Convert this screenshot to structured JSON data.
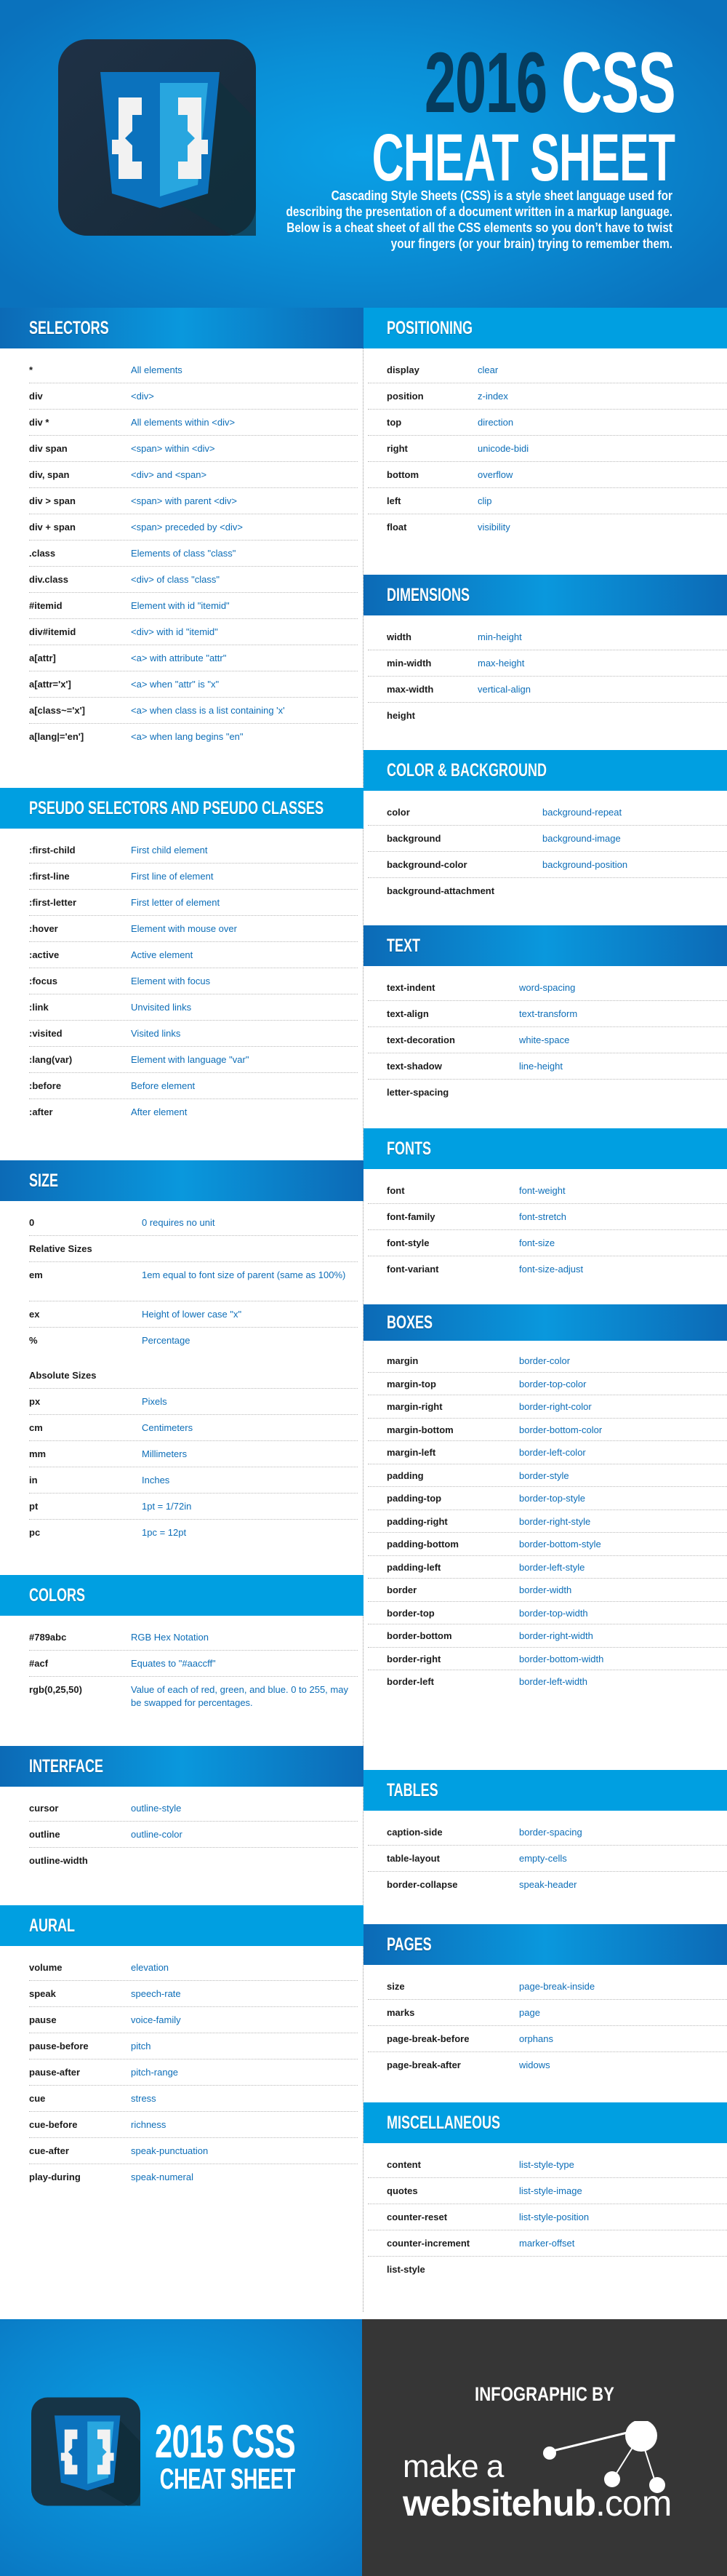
{
  "colors": {
    "accent_blue": "#009fe1",
    "dark_blue_header": "#0c6ab6",
    "title_navy": "#053c5e",
    "value_text_blue": "#0d6eb8",
    "footer_dark": "#363636"
  },
  "header": {
    "logo_icon": "css-braces-shield-icon",
    "title_year": "2016",
    "title_css": "CSS",
    "title_line2": "CHEAT SHEET",
    "intro": "Cascading Style Sheets (CSS) is a style sheet language used for describing the presentation of a document written in a markup language. Below is a cheat sheet of all the CSS elements so you don’t have to twist your fingers (or your brain) trying to remember them."
  },
  "left_column": {
    "selectors": {
      "title": "SELECTORS",
      "rows": [
        {
          "key": "*",
          "value": "All elements"
        },
        {
          "key": "div",
          "value": "<div>"
        },
        {
          "key": "div *",
          "value": "All elements within <div>"
        },
        {
          "key": "div span",
          "value": "<span> within <div>"
        },
        {
          "key": "div, span",
          "value": "<div> and <span>"
        },
        {
          "key": "div > span",
          "value": "<span> with parent <div>"
        },
        {
          "key": "div + span",
          "value": "<span> preceded by <div>"
        },
        {
          "key": ".class",
          "value": "Elements of class \"class\""
        },
        {
          "key": "div.class",
          "value": "<div> of class \"class\""
        },
        {
          "key": "#itemid",
          "value": "Element with id \"itemid\""
        },
        {
          "key": "div#itemid",
          "value": "<div> with id \"itemid\""
        },
        {
          "key": "a[attr]",
          "value": "<a> with attribute \"attr\""
        },
        {
          "key": "a[attr='x']",
          "value": "<a> when \"attr\" is \"x\""
        },
        {
          "key": "a[class~='x']",
          "value": "<a> when class is a list containing 'x'"
        },
        {
          "key": "a[lang|='en']",
          "value": "<a> when lang begins \"en\""
        }
      ]
    },
    "pseudo": {
      "title": "PSEUDO SELECTORS AND PSEUDO CLASSES",
      "rows": [
        {
          "key": ":first-child",
          "value": "First child element"
        },
        {
          "key": ":first-line",
          "value": "First line of element"
        },
        {
          "key": ":first-letter",
          "value": "First letter of element"
        },
        {
          "key": ":hover",
          "value": "Element with mouse over"
        },
        {
          "key": ":active",
          "value": "Active element"
        },
        {
          "key": ":focus",
          "value": "Element with focus"
        },
        {
          "key": ":link",
          "value": "Unvisited links"
        },
        {
          "key": ":visited",
          "value": "Visited links"
        },
        {
          "key": ":lang(var)",
          "value": "Element with language \"var\""
        },
        {
          "key": ":before",
          "value": "Before element"
        },
        {
          "key": ":after",
          "value": "After element"
        }
      ]
    },
    "size": {
      "title": "SIZE",
      "zero": {
        "key": "0",
        "value": "0 requires no unit"
      },
      "relative_label": "Relative Sizes",
      "relative": [
        {
          "key": "em",
          "value": "1em equal to font size of parent (same as 100%)"
        },
        {
          "key": "ex",
          "value": "Height of lower case \"x\""
        },
        {
          "key": "%",
          "value": "Percentage"
        }
      ],
      "absolute_label": "Absolute Sizes",
      "absolute": [
        {
          "key": "px",
          "value": "Pixels"
        },
        {
          "key": "cm",
          "value": "Centimeters"
        },
        {
          "key": "mm",
          "value": "Millimeters"
        },
        {
          "key": "in",
          "value": "Inches"
        },
        {
          "key": "pt",
          "value": "1pt = 1/72in"
        },
        {
          "key": "pc",
          "value": "1pc = 12pt"
        }
      ]
    },
    "colors": {
      "title": "COLORS",
      "rows": [
        {
          "key": "#789abc",
          "value": "RGB Hex Notation"
        },
        {
          "key": "#acf",
          "value": "Equates to \"#aaccff\""
        },
        {
          "key": "rgb(0,25,50)",
          "value": "Value of each of red, green, and blue. 0 to 255, may be swapped for percentages."
        }
      ]
    },
    "interface": {
      "title": "INTERFACE",
      "rows": [
        {
          "key": "cursor",
          "value": "outline-style"
        },
        {
          "key": "outline",
          "value": "outline-color"
        },
        {
          "key": "outline-width",
          "value": ""
        }
      ]
    },
    "aural": {
      "title": "AURAL",
      "rows": [
        {
          "key": "volume",
          "value": "elevation"
        },
        {
          "key": "speak",
          "value": "speech-rate"
        },
        {
          "key": "pause",
          "value": "voice-family"
        },
        {
          "key": "pause-before",
          "value": "pitch"
        },
        {
          "key": "pause-after",
          "value": "pitch-range"
        },
        {
          "key": "cue",
          "value": "stress"
        },
        {
          "key": "cue-before",
          "value": "richness"
        },
        {
          "key": "cue-after",
          "value": "speak-punctuation"
        },
        {
          "key": "play-during",
          "value": "speak-numeral"
        }
      ]
    }
  },
  "right_column": {
    "positioning": {
      "title": "POSITIONING",
      "rows": [
        {
          "key": "display",
          "value": "clear"
        },
        {
          "key": "position",
          "value": "z-index"
        },
        {
          "key": "top",
          "value": "direction"
        },
        {
          "key": "right",
          "value": "unicode-bidi"
        },
        {
          "key": "bottom",
          "value": "overflow"
        },
        {
          "key": "left",
          "value": "clip"
        },
        {
          "key": "float",
          "value": "visibility"
        }
      ]
    },
    "dimensions": {
      "title": "DIMENSIONS",
      "rows": [
        {
          "key": "width",
          "value": "min-height"
        },
        {
          "key": "min-width",
          "value": "max-height"
        },
        {
          "key": "max-width",
          "value": "vertical-align"
        },
        {
          "key": "height",
          "value": ""
        }
      ]
    },
    "color_background": {
      "title": "COLOR & BACKGROUND",
      "rows": [
        {
          "key": "color",
          "value": "background-repeat"
        },
        {
          "key": "background",
          "value": "background-image"
        },
        {
          "key": "background-color",
          "value": "background-position"
        },
        {
          "key": "background-attachment",
          "value": ""
        }
      ]
    },
    "text": {
      "title": "TEXT",
      "rows": [
        {
          "key": "text-indent",
          "value": "word-spacing"
        },
        {
          "key": "text-align",
          "value": "text-transform"
        },
        {
          "key": "text-decoration",
          "value": "white-space"
        },
        {
          "key": "text-shadow",
          "value": "line-height"
        },
        {
          "key": "letter-spacing",
          "value": ""
        }
      ]
    },
    "fonts": {
      "title": "FONTS",
      "rows": [
        {
          "key": "font",
          "value": "font-weight"
        },
        {
          "key": "font-family",
          "value": "font-stretch"
        },
        {
          "key": "font-style",
          "value": "font-size"
        },
        {
          "key": "font-variant",
          "value": "font-size-adjust"
        }
      ]
    },
    "boxes": {
      "title": "BOXES",
      "rows": [
        {
          "key": "margin",
          "value": "border-color"
        },
        {
          "key": "margin-top",
          "value": "border-top-color"
        },
        {
          "key": "margin-right",
          "value": "border-right-color"
        },
        {
          "key": "margin-bottom",
          "value": "border-bottom-color"
        },
        {
          "key": "margin-left",
          "value": "border-left-color"
        },
        {
          "key": "padding",
          "value": "border-style"
        },
        {
          "key": "padding-top",
          "value": "border-top-style"
        },
        {
          "key": "padding-right",
          "value": "border-right-style"
        },
        {
          "key": "padding-bottom",
          "value": "border-bottom-style"
        },
        {
          "key": "padding-left",
          "value": "border-left-style"
        },
        {
          "key": "border",
          "value": "border-width"
        },
        {
          "key": "border-top",
          "value": "border-top-width"
        },
        {
          "key": "border-bottom",
          "value": "border-right-width"
        },
        {
          "key": "border-right",
          "value": "border-bottom-width"
        },
        {
          "key": "border-left",
          "value": "border-left-width"
        }
      ]
    },
    "tables": {
      "title": "TABLES",
      "rows": [
        {
          "key": "caption-side",
          "value": "border-spacing"
        },
        {
          "key": "table-layout",
          "value": "empty-cells"
        },
        {
          "key": "border-collapse",
          "value": "speak-header"
        }
      ]
    },
    "pages": {
      "title": "PAGES",
      "rows": [
        {
          "key": "size",
          "value": "page-break-inside"
        },
        {
          "key": "marks",
          "value": "page"
        },
        {
          "key": "page-break-before",
          "value": "orphans"
        },
        {
          "key": "page-break-after",
          "value": "widows"
        }
      ]
    },
    "miscellaneous": {
      "title": "MISCELLANEOUS",
      "rows": [
        {
          "key": "content",
          "value": "list-style-type"
        },
        {
          "key": "quotes",
          "value": "list-style-image"
        },
        {
          "key": "counter-reset",
          "value": "list-style-position"
        },
        {
          "key": "counter-increment",
          "value": "marker-offset"
        },
        {
          "key": "list-style",
          "value": ""
        }
      ]
    }
  },
  "footer": {
    "logo_icon": "css-braces-shield-icon",
    "title_line1": "2015 CSS",
    "title_line2": "CHEAT SHEET",
    "credit_label": "INFOGRAPHIC BY",
    "brand_line1": "make a",
    "brand_bold": "websitehub",
    "brand_suffix": ".com",
    "brand_icon": "connected-nodes-icon"
  }
}
